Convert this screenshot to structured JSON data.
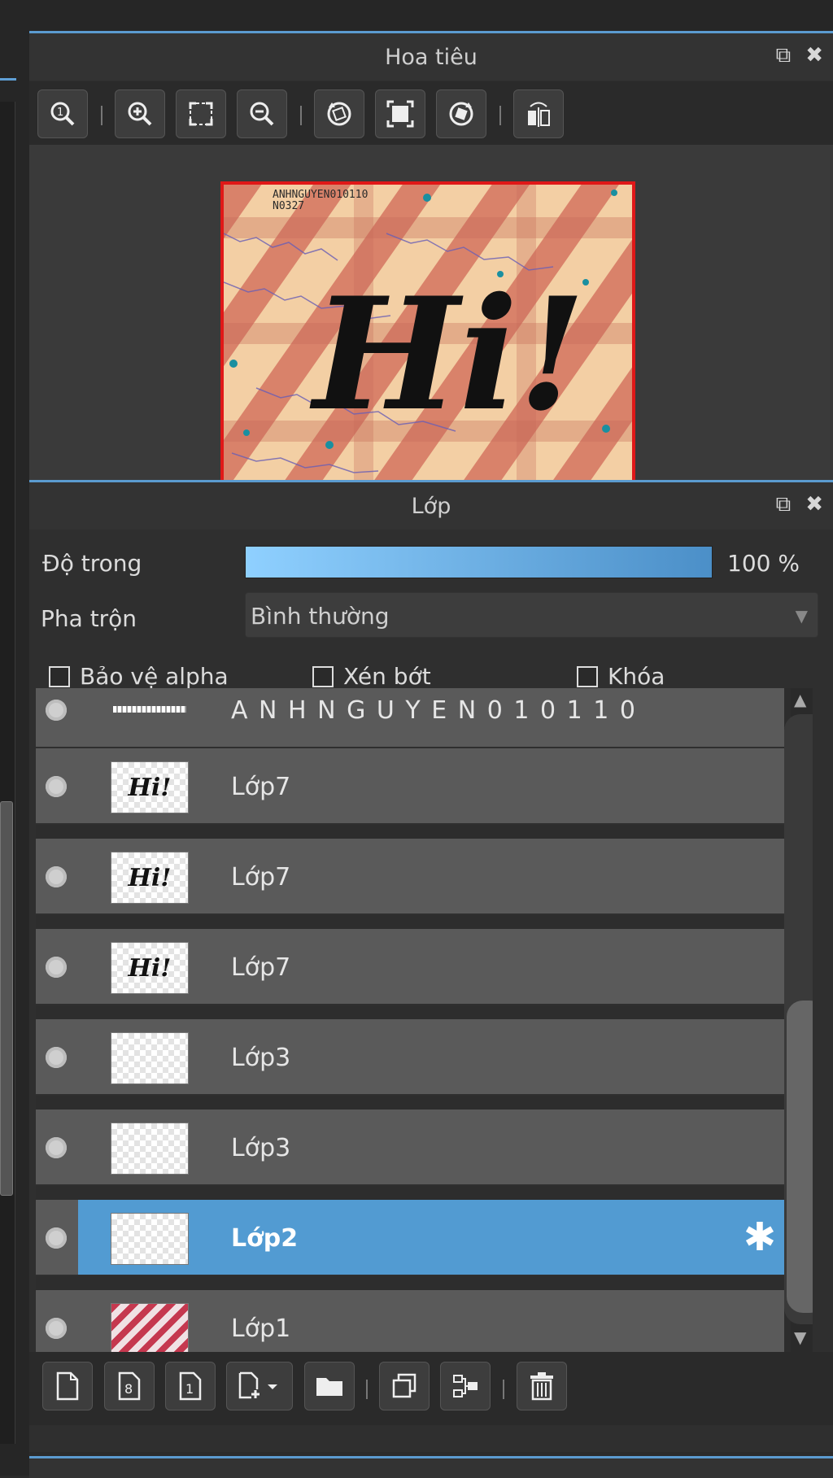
{
  "navigator": {
    "title": "Hoa tiêu",
    "preview_text": "Hi!",
    "preview_caption": "ANHNGUYEN010110 ",
    "preview_caption2": "N0327"
  },
  "layers_panel": {
    "title": "Lớp",
    "opacity_label": "Độ trong",
    "opacity_value": "100 %",
    "opacity_fraction": 1.0,
    "blend_label": "Pha trộn",
    "blend_value": "Bình thường",
    "protect_alpha": "Bảo vệ alpha",
    "clip": "Xén bớt",
    "lock": "Khóa",
    "layers": [
      {
        "name": "A N H N G U Y E N 0 1 0 1 1 0",
        "thumb": "text"
      },
      {
        "name": "Lớp7",
        "thumb": "hi"
      },
      {
        "name": "Lớp7",
        "thumb": "hi"
      },
      {
        "name": "Lớp7",
        "thumb": "hi"
      },
      {
        "name": "Lớp3",
        "thumb": "empty"
      },
      {
        "name": "Lớp3",
        "thumb": "empty"
      },
      {
        "name": "Lớp2",
        "thumb": "empty",
        "selected": true
      },
      {
        "name": "Lớp1",
        "thumb": "stripes"
      }
    ],
    "thumb_hi_text": "Hi!"
  },
  "icons": {
    "popout": "⧉",
    "close": "✖",
    "gear": "✱"
  },
  "colors": {
    "accent": "#529bd2",
    "preview_border": "#e01818"
  }
}
